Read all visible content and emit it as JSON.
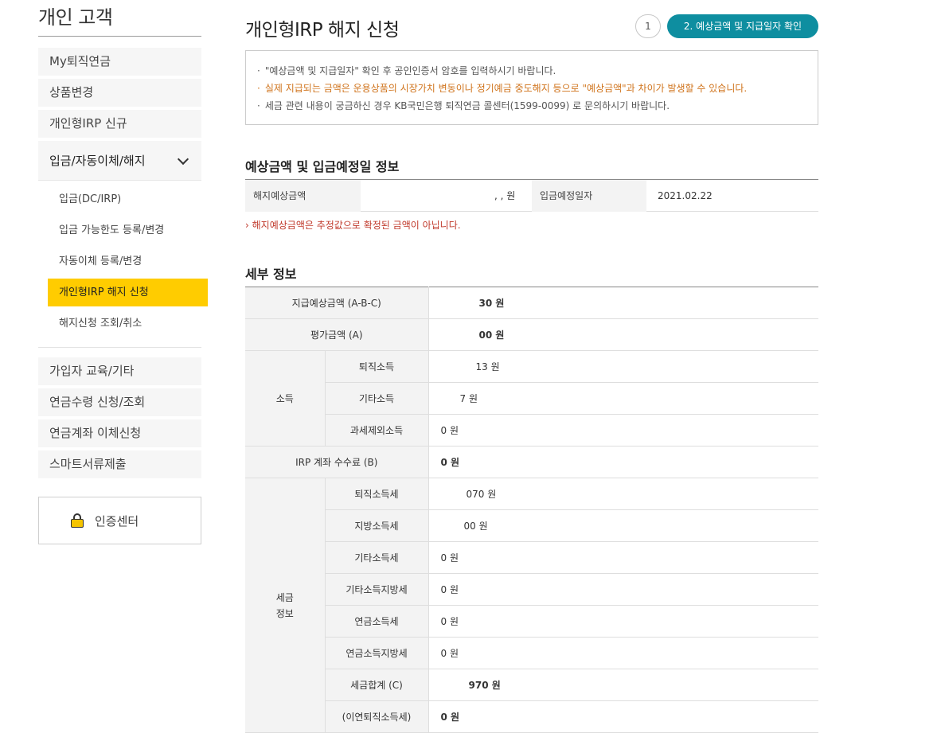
{
  "sidebar": {
    "title": "개인 고객",
    "items_top": [
      "My퇴직연금",
      "상품변경",
      "개인형IRP 신규"
    ],
    "open_section": "입금/자동이체/해지",
    "sub_items": [
      "입금(DC/IRP)",
      "입금 가능한도 등록/변경",
      "자동이체 등록/변경",
      "개인형IRP 해지 신청",
      "해지신청 조회/취소"
    ],
    "items_bottom": [
      "가입자 교육/기타",
      "연금수령 신청/조회",
      "연금계좌 이체신청",
      "스마트서류제출"
    ],
    "auth": "인증센터"
  },
  "header": {
    "title": "개인형IRP 해지 신청",
    "step1": "1",
    "step2": "2. 예상금액 및 지급일자 확인"
  },
  "notice": [
    "\"예상금액 및 지급일자\" 확인 후 공인인증서 암호를 입력하시기 바랍니다.",
    "실제 지급되는 금액은 운용상품의 시장가치 변동이나 정기예금 중도해지 등으로 \"예상금액\"과 차이가 발생할 수 있습니다.",
    "세금 관련 내용이 궁금하신 경우 KB국민은행 퇴직연금 콜센터(1599-0099) 로 문의하시기 바랍니다."
  ],
  "section1": {
    "title": "예상금액 및 입금예정일 정보",
    "label_amount": "해지예상금액",
    "value_amount": ",   ,   원",
    "label_date": "입금예정일자",
    "value_date": "2021.02.22",
    "note": "› 해지예상금액은 추정값으로 확정된 금액이 아닙니다."
  },
  "section2": {
    "title": "세부 정보",
    "rows": {
      "r1_label": "지급예상금액 (A-B-C)",
      "r1_value": "30 원",
      "r2_label": "평가금액 (A)",
      "r2_value": "00 원",
      "income_group": "소득",
      "r3_label": "퇴직소득",
      "r3_value": "13 원",
      "r4_label": "기타소득",
      "r4_value": "7 원",
      "r5_label": "과세제외소득",
      "r5_value": "0 원",
      "r6_label": "IRP 계좌 수수료 (B)",
      "r6_value": "0 원",
      "tax_group": "세금\n정보",
      "r7_label": "퇴직소득세",
      "r7_value": "070 원",
      "r8_label": "지방소득세",
      "r8_value": "00 원",
      "r9_label": "기타소득세",
      "r9_value": "0 원",
      "r10_label": "기타소득지방세",
      "r10_value": "0 원",
      "r11_label": "연금소득세",
      "r11_value": "0 원",
      "r12_label": "연금소득지방세",
      "r12_value": "0 원",
      "r13_label": "세금합계 (C)",
      "r13_value": "970 원",
      "r14_label": "(이연퇴직소득세)",
      "r14_value": "0 원"
    }
  }
}
